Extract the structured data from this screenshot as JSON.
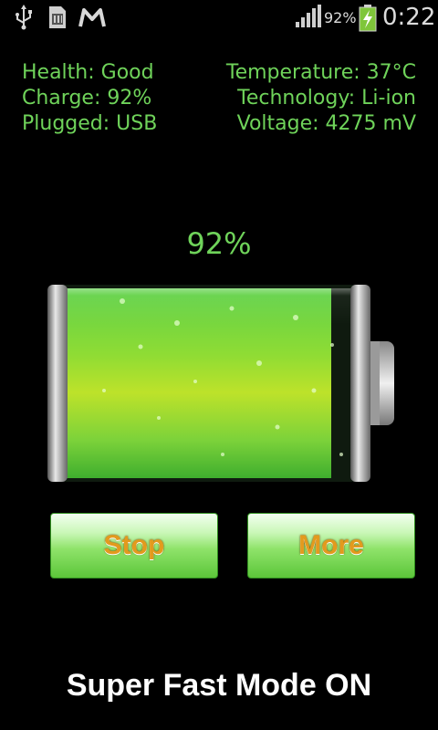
{
  "status_bar": {
    "battery_percent": "92%",
    "time": "0:22",
    "icons": [
      "usb-icon",
      "sd-card-icon",
      "gmail-icon",
      "signal-icon",
      "battery-charging-icon"
    ]
  },
  "info": {
    "health": "Health: Good",
    "charge": "Charge: 92%",
    "plugged": "Plugged: USB",
    "temperature": "Temperature: 37°C",
    "technology": "Technology: Li-ion",
    "voltage": "Voltage: 4275 mV"
  },
  "battery": {
    "percent_label": "92%",
    "level": 0.92
  },
  "buttons": {
    "stop": "Stop",
    "more": "More"
  },
  "mode_text": "Super Fast Mode ON",
  "colors": {
    "accent_green": "#6fd35a",
    "button_text": "#e39a1d",
    "background": "#000000"
  }
}
